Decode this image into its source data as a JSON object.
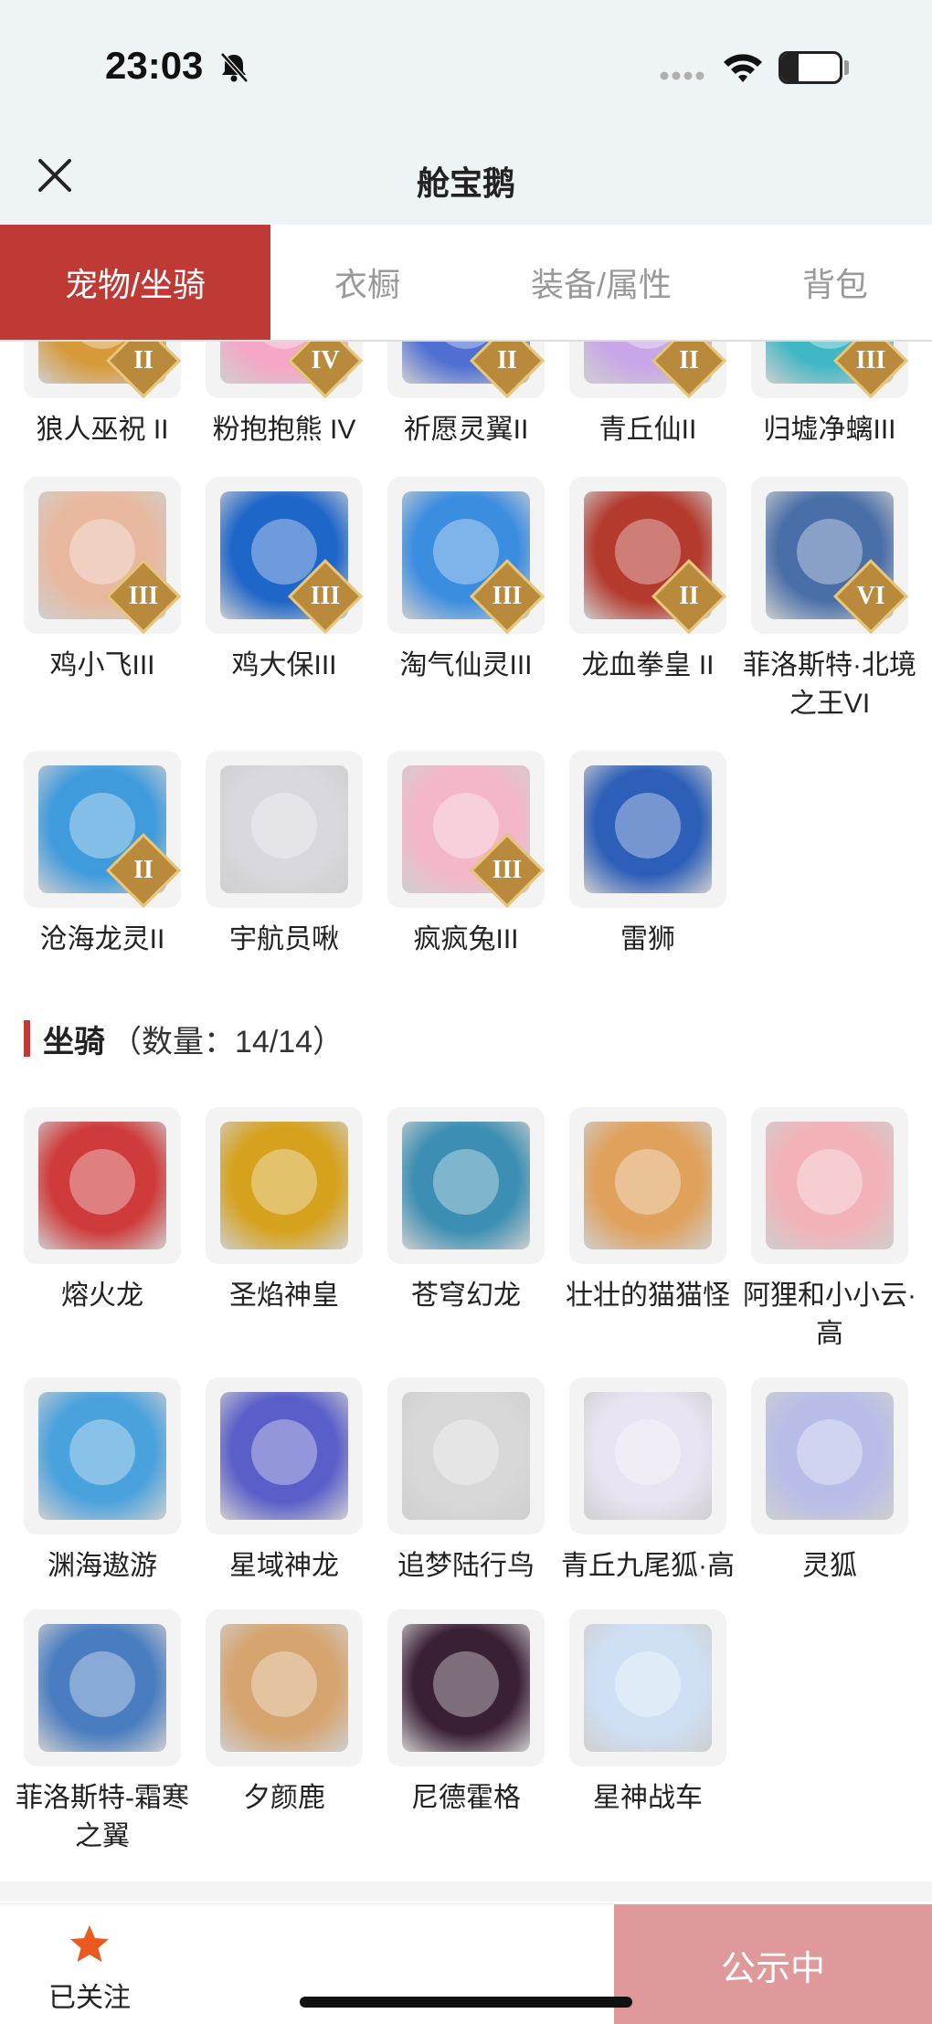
{
  "status_bar": {
    "time": "23:03",
    "battery": "30",
    "battery_level": 0.3
  },
  "header": {
    "title": "舱宝鹅"
  },
  "tabs": [
    {
      "label": "宠物/坐骑",
      "active": true
    },
    {
      "label": "衣橱",
      "active": false
    },
    {
      "label": "装备/属性",
      "active": false
    },
    {
      "label": "背包",
      "active": false
    }
  ],
  "pets": [
    {
      "name": "狼人巫祝 II",
      "badge": "II",
      "color": "#d69a3b"
    },
    {
      "name": "粉抱抱熊 IV",
      "badge": "IV",
      "color": "#f6a6c6"
    },
    {
      "name": "祈愿灵翼II",
      "badge": "II",
      "color": "#4f6fd3"
    },
    {
      "name": "青丘仙II",
      "badge": "II",
      "color": "#c9a6e8"
    },
    {
      "name": "归墟净螭III",
      "badge": "III",
      "color": "#3fb7c4"
    },
    {
      "name": "鸡小飞III",
      "badge": "III",
      "color": "#e8b9a0"
    },
    {
      "name": "鸡大保III",
      "badge": "III",
      "color": "#1f66c9"
    },
    {
      "name": "淘气仙灵III",
      "badge": "III",
      "color": "#3b8de0"
    },
    {
      "name": "龙血拳皇 II",
      "badge": "II",
      "color": "#b43a2e"
    },
    {
      "name": "菲洛斯特·北境之王VI",
      "badge": "VI",
      "color": "#4a6fa8"
    },
    {
      "name": "沧海龙灵II",
      "badge": "II",
      "color": "#3f9bdc"
    },
    {
      "name": "宇航员啾",
      "badge": "",
      "color": "#d8d8de"
    },
    {
      "name": "疯疯兔III",
      "badge": "III",
      "color": "#f4b7c9"
    },
    {
      "name": "雷狮",
      "badge": "",
      "color": "#2d5fb8"
    }
  ],
  "mounts_section": {
    "title": "坐骑",
    "count": "（数量：14/14）"
  },
  "mounts": [
    {
      "name": "熔火龙",
      "badge": "",
      "color": "#cf3b3b"
    },
    {
      "name": "圣焰神皇",
      "badge": "",
      "color": "#d6a21e"
    },
    {
      "name": "苍穹幻龙",
      "badge": "",
      "color": "#3c8fb3"
    },
    {
      "name": "壮壮的猫猫怪",
      "badge": "",
      "color": "#e0a15c"
    },
    {
      "name": "阿狸和小小云·高",
      "badge": "",
      "color": "#f1b3b8"
    },
    {
      "name": "渊海遨游",
      "badge": "",
      "color": "#4aa2dd"
    },
    {
      "name": "星域神龙",
      "badge": "",
      "color": "#5a5ec8"
    },
    {
      "name": "追梦陆行鸟",
      "badge": "",
      "color": "#d8d8d8"
    },
    {
      "name": "青丘九尾狐·高",
      "badge": "",
      "color": "#e9e4f3"
    },
    {
      "name": "灵狐",
      "badge": "",
      "color": "#b8bde8"
    },
    {
      "name": "菲洛斯特-霜寒之翼",
      "badge": "",
      "color": "#4a7dc0"
    },
    {
      "name": "夕颜鹿",
      "badge": "",
      "color": "#d6a46f"
    },
    {
      "name": "尼德霍格",
      "badge": "",
      "color": "#3a2035"
    },
    {
      "name": "星神战车",
      "badge": "",
      "color": "#cfe0f5"
    }
  ],
  "bottom_bar": {
    "follow_label": "已关注",
    "status_button": "公示中"
  }
}
